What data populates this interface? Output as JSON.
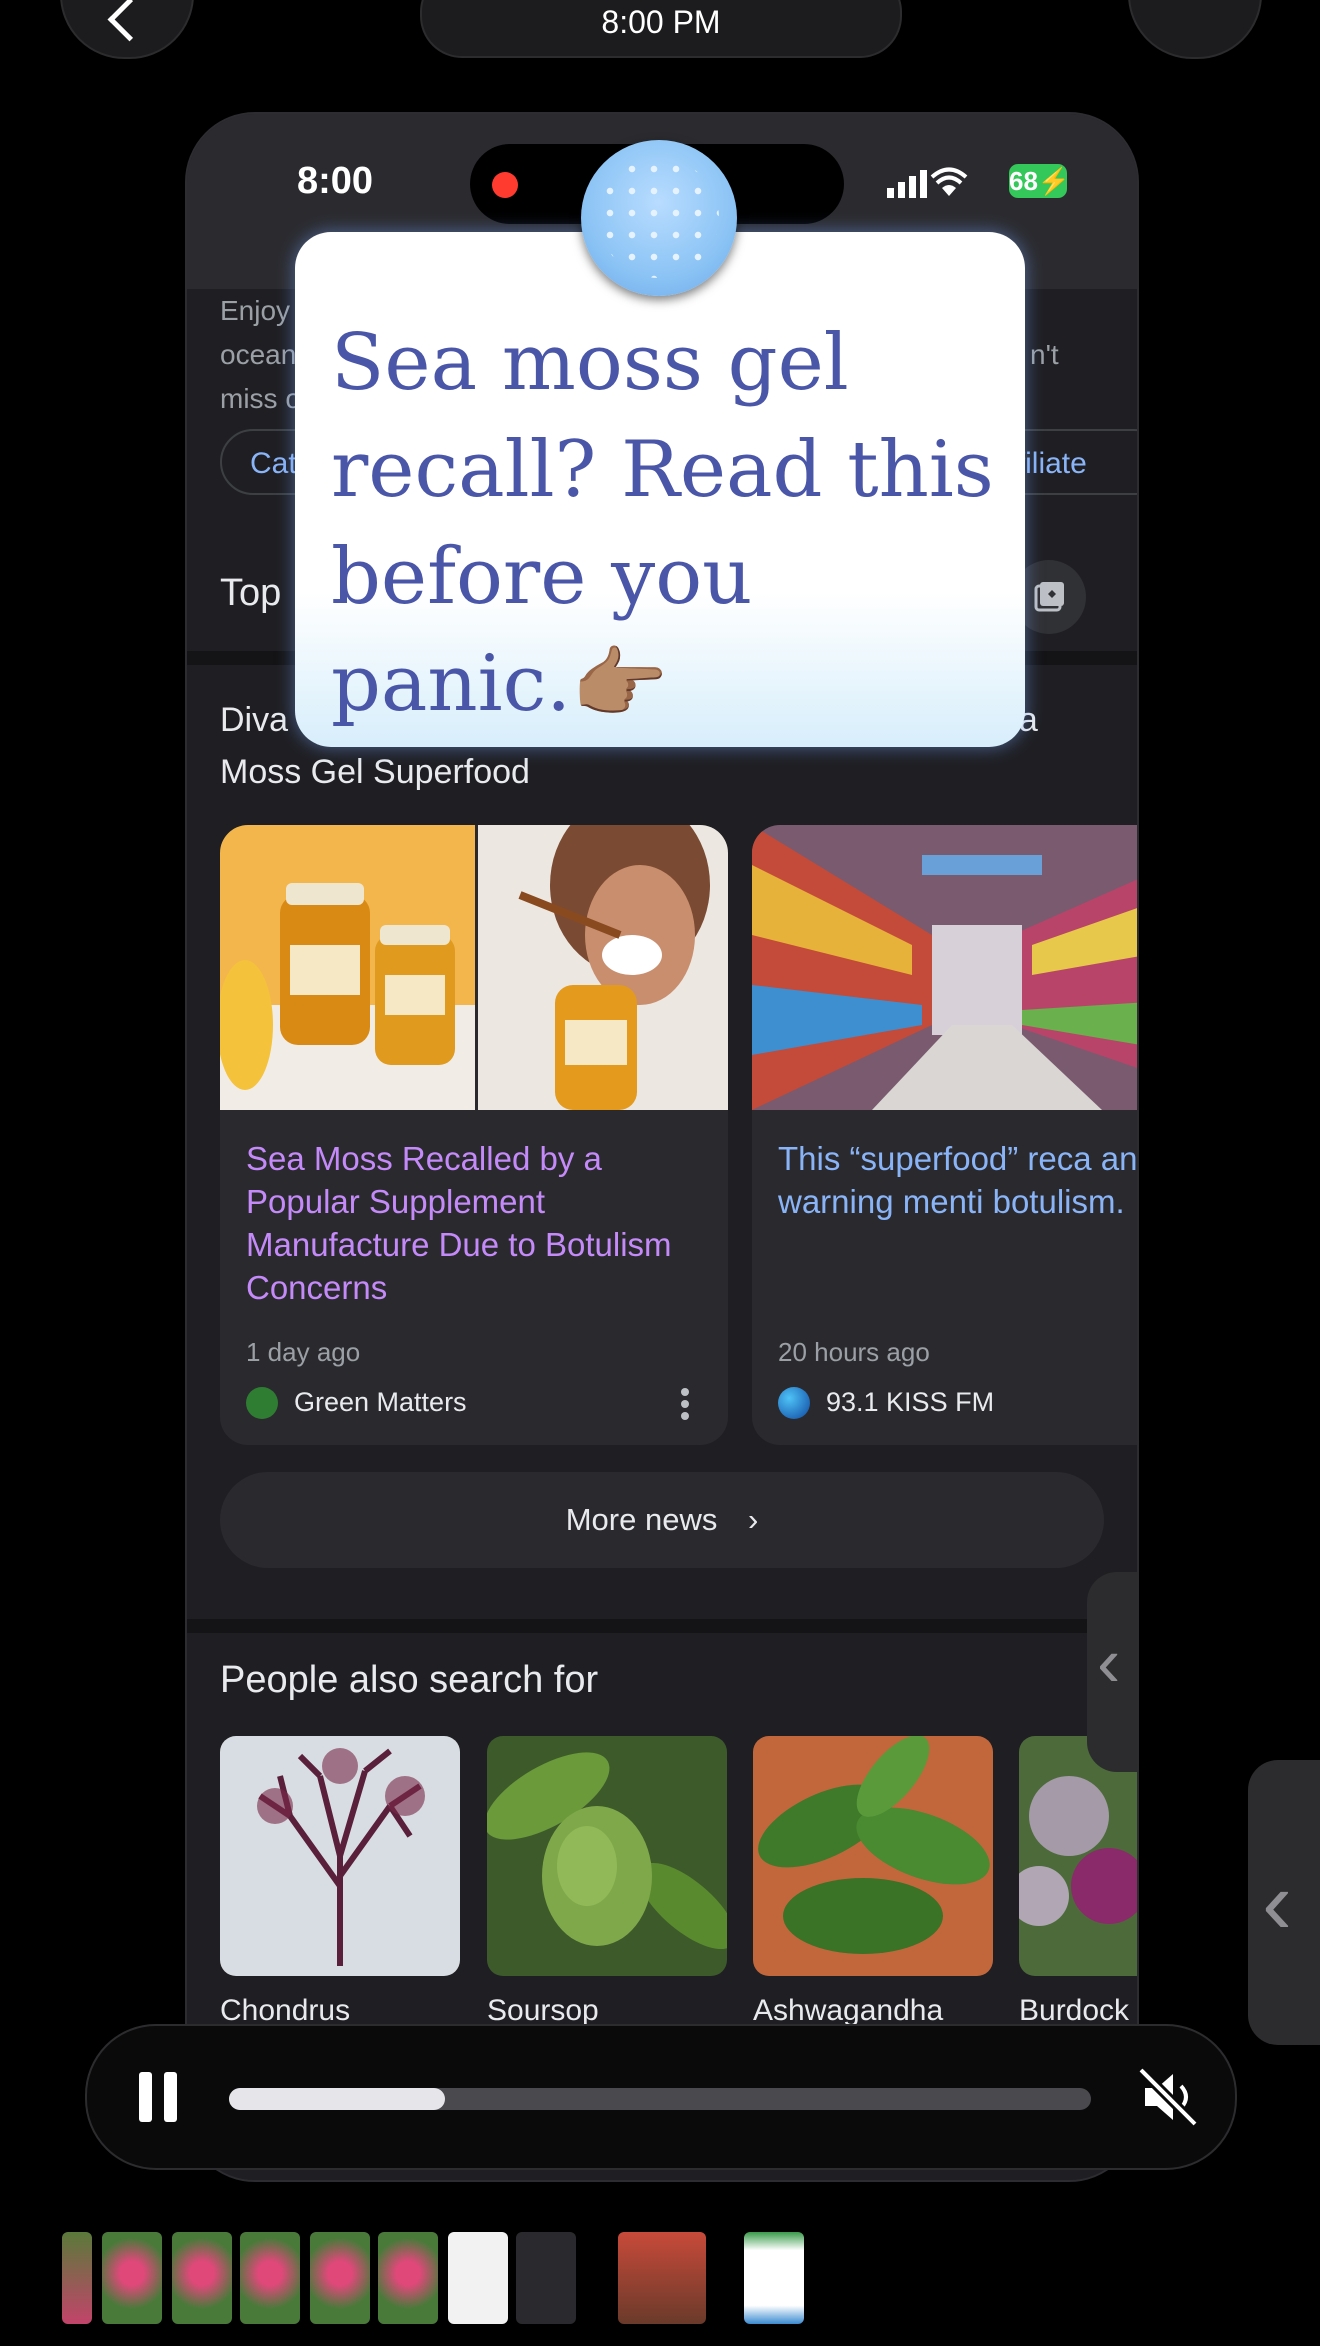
{
  "top_bar": {
    "time": "8:00 PM"
  },
  "status_bar": {
    "time": "8:00",
    "battery": "68"
  },
  "intro": {
    "text_line1": "Enjoy",
    "text_line2": "ocean",
    "text_line2_right": "n't",
    "text_line3": "miss o",
    "chip_left": "Cat",
    "chip_right": "ffiliate"
  },
  "top_stories": {
    "title": "Top",
    "headline_left": "Diva",
    "headline_right": "ea",
    "headline_line2": "Moss Gel Superfood",
    "cards": [
      {
        "title": "Sea Moss Recalled by a Popular Supplement Manufacture Due to Botulism Concerns",
        "time": "1 day ago",
        "source": "Green Matters",
        "title_color": "#c58af9"
      },
      {
        "title": "This “superfood” reca and the warning menti botulism.",
        "time": "20 hours ago",
        "source": "93.1 KISS FM",
        "title_color": "#8ab4f8"
      }
    ],
    "more_news": "More news"
  },
  "people_also_search": {
    "title": "People also search for",
    "items": [
      "Chondrus",
      "Soursop",
      "Ashwagandha",
      "Burdock"
    ]
  },
  "caption": {
    "text": "Sea moss gel recall? Read this before you panic.👉🏽"
  },
  "player": {
    "progress": 0.25
  }
}
